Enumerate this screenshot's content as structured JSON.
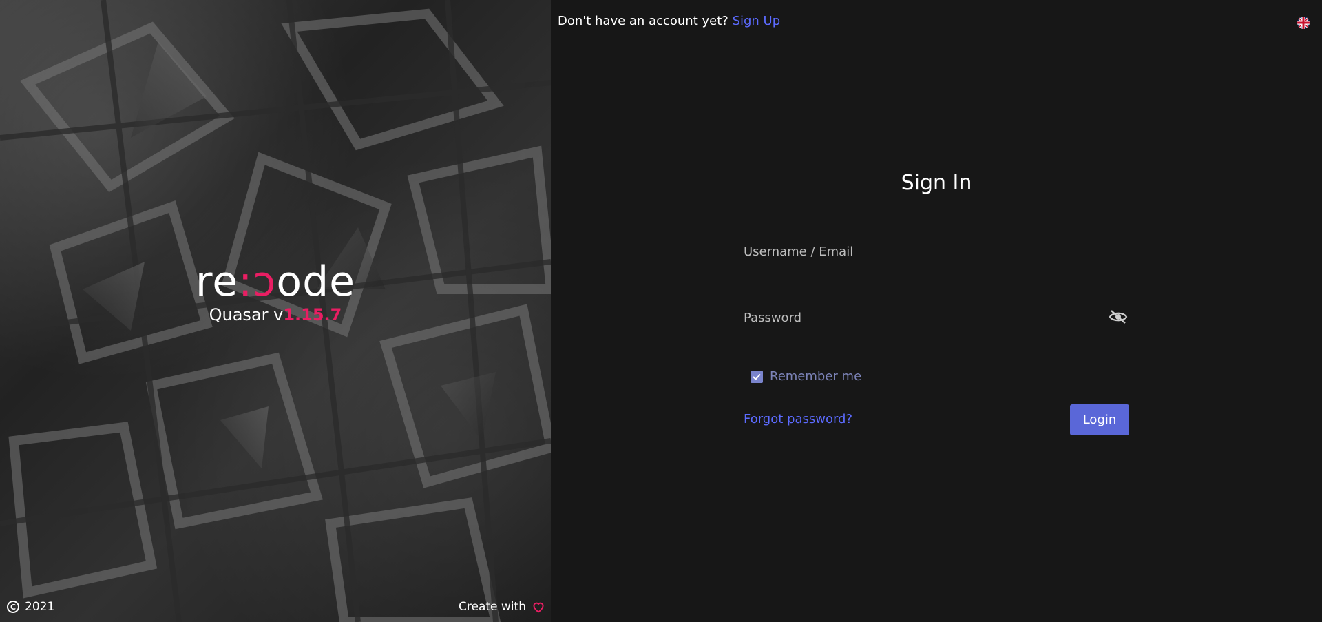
{
  "left_panel": {
    "logo": {
      "part1": "re",
      "accent": ":ɔ",
      "part2": "ode"
    },
    "version": {
      "prefix": "Quasar v",
      "number": "1.15.7"
    },
    "copyright": {
      "icon": "copyright-icon",
      "year": "2021"
    },
    "made_with": {
      "label": "Create with",
      "icon": "heart-icon"
    },
    "accent_color": "#e91e63"
  },
  "header": {
    "prompt": "Don't have an account yet?",
    "signup_link": "Sign Up",
    "language_icon": "uk-flag-icon"
  },
  "form": {
    "title": "Sign In",
    "username": {
      "placeholder": "Username / Email",
      "value": ""
    },
    "password": {
      "placeholder": "Password",
      "value": "",
      "toggle_icon": "eye-off-icon"
    },
    "remember": {
      "label": "Remember me",
      "checked": true
    },
    "forgot_link": "Forgot password?",
    "submit_label": "Login"
  },
  "colors": {
    "background": "#171717",
    "link": "#5c6bff",
    "button": "#5a67d8",
    "checkbox": "#7a84cc"
  }
}
